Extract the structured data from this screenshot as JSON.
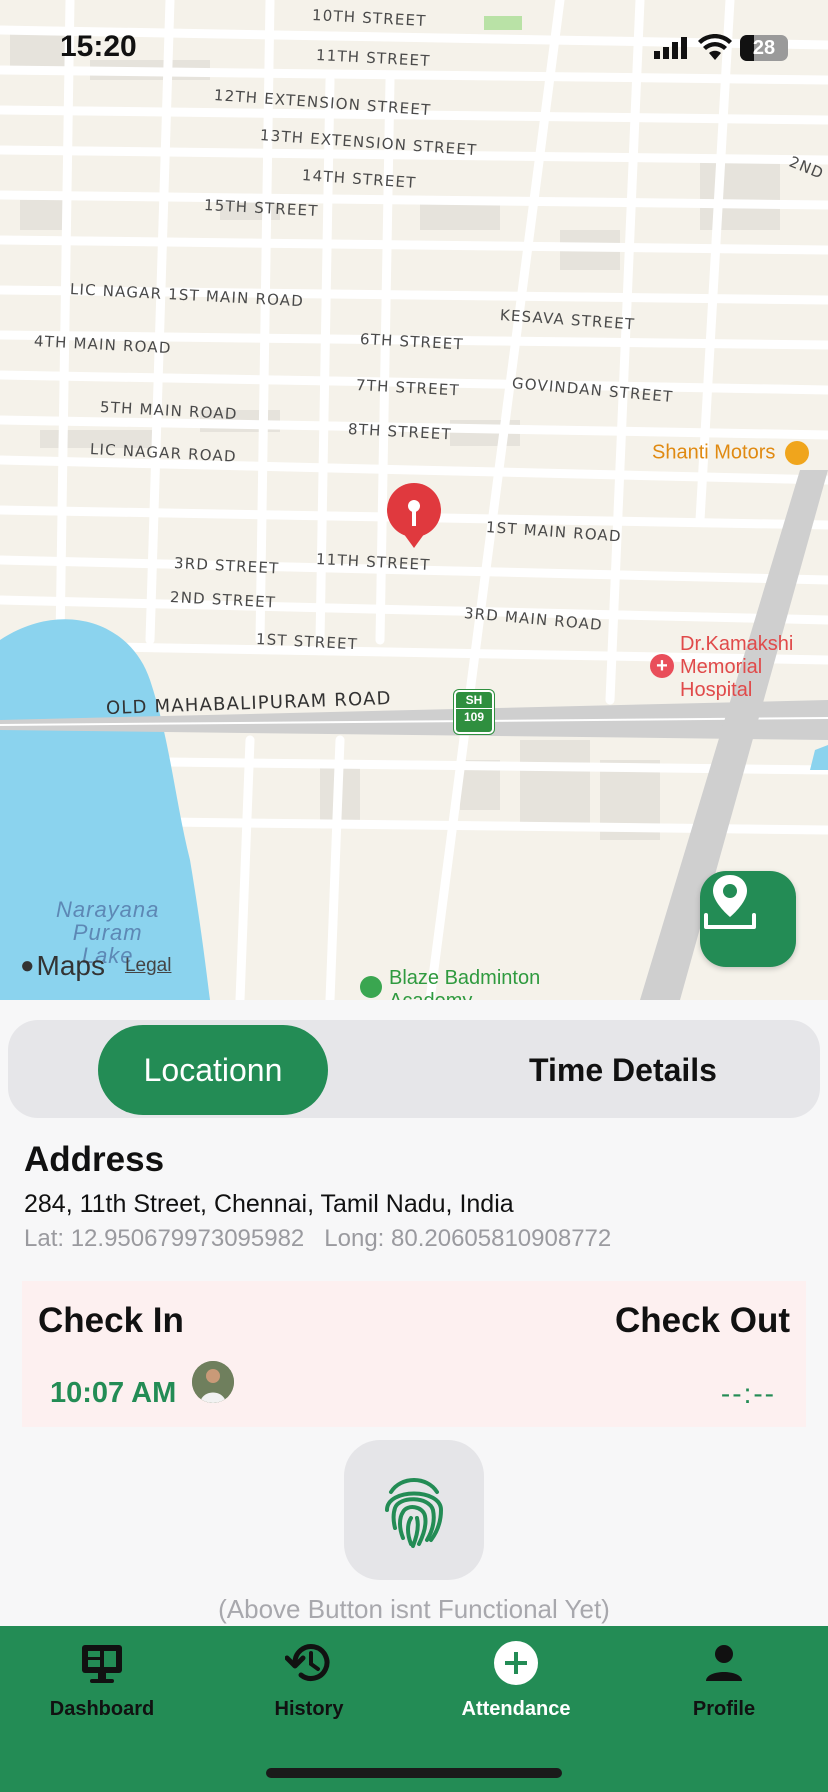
{
  "status_bar": {
    "time": "15:20",
    "battery": "28"
  },
  "map": {
    "streets": [
      "10TH STREET",
      "11TH STREET",
      "12TH EXTENSION STREET",
      "13TH EXTENSION STREET",
      "14TH STREET",
      "15TH STREET",
      "2ND",
      "LIC NAGAR 1ST MAIN ROAD",
      "KESAVA STREET",
      "4TH MAIN ROAD",
      "6TH STREET",
      "7TH STREET",
      "GOVINDAN STREET",
      "5TH MAIN ROAD",
      "8TH STREET",
      "LIC NAGAR ROAD",
      "1ST MAIN ROAD",
      "3RD STREET",
      "11TH STREET",
      "2ND STREET",
      "3RD MAIN ROAD",
      "1ST STREET",
      "OLD MAHABALIPURAM ROAD"
    ],
    "highway_shield": {
      "top": "SH",
      "number": "109"
    },
    "pois": [
      {
        "name": "Shanti Motors",
        "color": "#e08a12"
      },
      {
        "name": "Dr.Kamakshi\nMemorial\nHospital",
        "color": "#e04a4a"
      },
      {
        "name": "Blaze Badminton\nAcademy",
        "color": "#2f9a3f"
      }
    ],
    "lake": "Narayana\nPuram\nLake",
    "attribution": {
      "brand": "Maps",
      "legal": "Legal"
    }
  },
  "segment": {
    "active_label": "Locationn",
    "inactive_label": "Time Details"
  },
  "address": {
    "title": "Address",
    "line": "284, 11th Street, Chennai, Tamil Nadu, India",
    "coords": "Lat: 12.950679973095982   Long: 80.20605810908772"
  },
  "attendance": {
    "check_in_label": "Check In",
    "check_out_label": "Check Out",
    "check_in_time": "10:07 AM",
    "check_out_time": "--:--"
  },
  "fingerprint_note": "(Above Button isnt Functional Yet)",
  "tabs": [
    {
      "label": "Dashboard",
      "icon": "dashboard-icon",
      "active": false
    },
    {
      "label": "History",
      "icon": "history-icon",
      "active": false
    },
    {
      "label": "Attendance",
      "icon": "add-circle-icon",
      "active": true
    },
    {
      "label": "Profile",
      "icon": "person-icon",
      "active": false
    }
  ],
  "colors": {
    "accent": "#238c55",
    "card_bg": "#fdf0f0"
  }
}
